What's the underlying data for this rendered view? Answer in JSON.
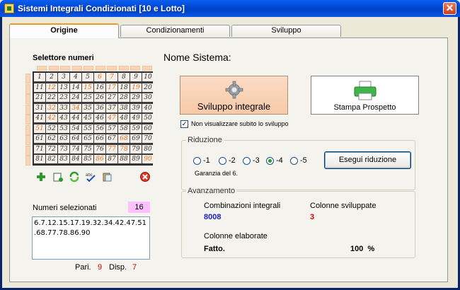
{
  "window": {
    "title": "Sistemi Integrali Condizionati  [10 e Lotto]",
    "close_glyph": "✕"
  },
  "tabs": [
    {
      "label": "Origine",
      "active": true
    },
    {
      "label": "Condizionamenti",
      "active": false
    },
    {
      "label": "Sviluppo",
      "active": false
    }
  ],
  "selector": {
    "title": "Selettore numeri",
    "numbers": [
      "1",
      "2",
      "3",
      "4",
      "5",
      "6",
      "7",
      "8",
      "9",
      "10",
      "11",
      "12",
      "13",
      "14",
      "15",
      "16",
      "17",
      "18",
      "19",
      "20",
      "21",
      "22",
      "23",
      "24",
      "25",
      "26",
      "27",
      "28",
      "29",
      "30",
      "31",
      "32",
      "33",
      "34",
      "35",
      "36",
      "37",
      "38",
      "39",
      "40",
      "41",
      "42",
      "43",
      "44",
      "45",
      "46",
      "47",
      "48",
      "49",
      "50",
      "51",
      "52",
      "53",
      "54",
      "55",
      "56",
      "57",
      "58",
      "59",
      "60",
      "61",
      "62",
      "63",
      "64",
      "65",
      "66",
      "67",
      "68",
      "69",
      "70",
      "71",
      "72",
      "73",
      "74",
      "75",
      "76",
      "77",
      "78",
      "79",
      "80",
      "81",
      "82",
      "83",
      "84",
      "85",
      "86",
      "87",
      "88",
      "89",
      "90"
    ],
    "selected": [
      6,
      7,
      12,
      15,
      17,
      19,
      32,
      34,
      42,
      47,
      51,
      68,
      77,
      78,
      86,
      90
    ]
  },
  "toolbar_icons": [
    "add-icon",
    "new-sheet-icon",
    "refresh-icon",
    "spellcheck-icon",
    "paste-icon",
    "delete-icon"
  ],
  "selected_numbers": {
    "label": "Numeri selezionati",
    "count": "16",
    "value": "6.7.12.15.17.19.32.34.42.47.51.68.77.78.86.90",
    "pari_label": "Pari.",
    "pari": "9",
    "disp_label": "Disp.",
    "disp": "7"
  },
  "system": {
    "name_label": "Nome Sistema:",
    "sviluppo_button": "Sviluppo integrale",
    "stampa_button": "Stampa Prospetto",
    "no_view_checkbox": "Non visualizzare subito lo sviluppo",
    "no_view_checked": true
  },
  "riduzione": {
    "title": "Riduzione",
    "options": [
      "-1",
      "-2",
      "-3",
      "-4",
      "-5"
    ],
    "selected": "-4",
    "garanzia": "Garanzia del 6.",
    "execute_button": "Esegui riduzione"
  },
  "avanzamento": {
    "title": "Avanzamento",
    "comb_label": "Combinazioni integrali",
    "comb_value": "8008",
    "col_svil_label": "Colonne sviluppate",
    "col_svil_value": "3",
    "col_elab_label": "Colonne elaborate",
    "status": "Fatto.",
    "percent": "100  %"
  },
  "colors": {
    "accent_orange": "#e07020",
    "count_bg": "#ffc0ff",
    "blue_value": "#2020c0",
    "red_value": "#d00000"
  }
}
